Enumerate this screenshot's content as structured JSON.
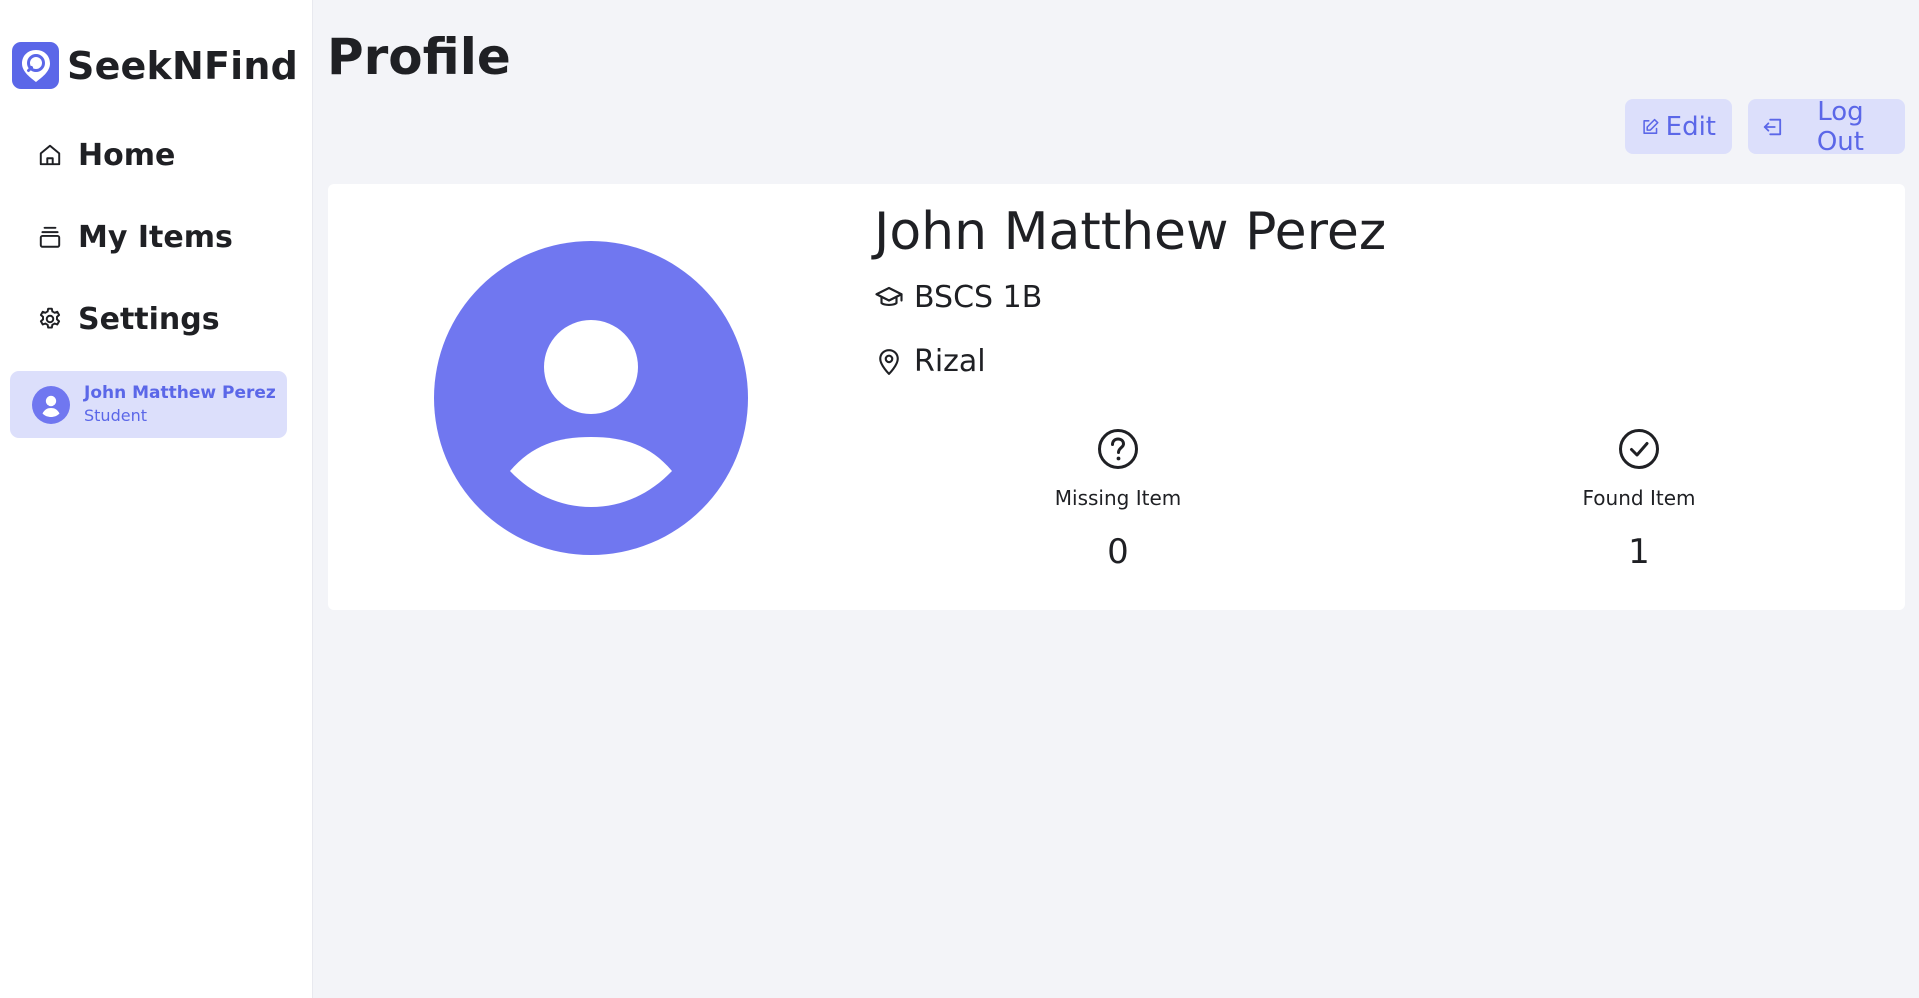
{
  "app": {
    "name": "SeekNFind",
    "brand_color": "#5b67e8"
  },
  "sidebar": {
    "items": [
      {
        "label": "Home",
        "icon": "home-icon"
      },
      {
        "label": "My Items",
        "icon": "stack-icon"
      },
      {
        "label": "Settings",
        "icon": "gear-icon"
      }
    ],
    "user": {
      "name": "John Matthew Perez",
      "role": "Student",
      "icon": "user-circle-icon"
    }
  },
  "page": {
    "title": "Profile"
  },
  "actions": {
    "edit_label": "Edit",
    "logout_label": "Log Out"
  },
  "profile": {
    "name": "John Matthew Perez",
    "course": "BSCS 1B",
    "location": "Rizal",
    "avatar_color": "#7077f0"
  },
  "stats": {
    "missing": {
      "label": "Missing Item",
      "value": "0",
      "icon": "question-circle-icon"
    },
    "found": {
      "label": "Found Item",
      "value": "1",
      "icon": "check-circle-icon"
    }
  }
}
